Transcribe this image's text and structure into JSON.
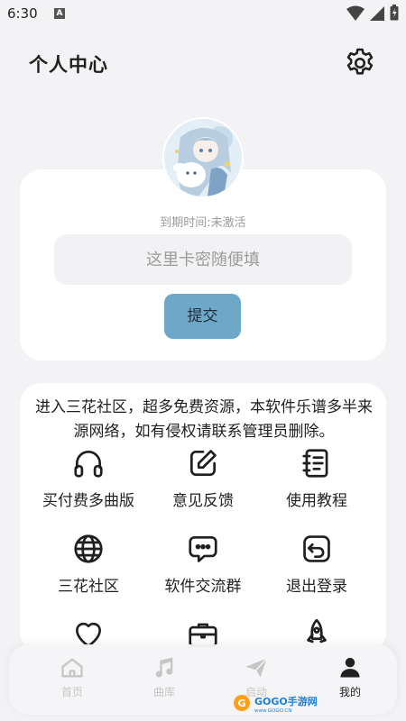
{
  "status_bar": {
    "time": "6:30",
    "notification_letter": "A"
  },
  "header": {
    "title": "个人中心",
    "settings_icon": "gear-icon"
  },
  "profile": {
    "avatar_icon": "anime-avatar",
    "expire_text": "到期时间:未激活",
    "code_placeholder": "这里卡密随便填",
    "code_value": "",
    "submit_label": "提交",
    "accent_color": "#6ea8c9"
  },
  "notice": "进入三花社区，超多免费资源，本软件乐谱多半来源网络，如有侵权请联系管理员删除。",
  "menu": {
    "items": [
      {
        "label": "买付费多曲版",
        "icon": "headphones-icon"
      },
      {
        "label": "意见反馈",
        "icon": "edit-icon"
      },
      {
        "label": "使用教程",
        "icon": "notebook-icon"
      },
      {
        "label": "三花社区",
        "icon": "globe-icon"
      },
      {
        "label": "软件交流群",
        "icon": "chat-bubble-icon"
      },
      {
        "label": "退出登录",
        "icon": "logout-icon"
      },
      {
        "label": "",
        "icon": "heart-icon"
      },
      {
        "label": "",
        "icon": "briefcase-icon"
      },
      {
        "label": "",
        "icon": "rocket-icon"
      }
    ]
  },
  "bottom_nav": {
    "items": [
      {
        "label": "首页",
        "icon": "home-icon",
        "active": false
      },
      {
        "label": "曲库",
        "icon": "music-note-icon",
        "active": false
      },
      {
        "label": "启动",
        "icon": "paper-plane-icon",
        "active": false
      },
      {
        "label": "我的",
        "icon": "user-icon",
        "active": true
      }
    ]
  },
  "watermark": {
    "text": "GOGO手游网",
    "url_text": "www.GOGO.CN"
  }
}
